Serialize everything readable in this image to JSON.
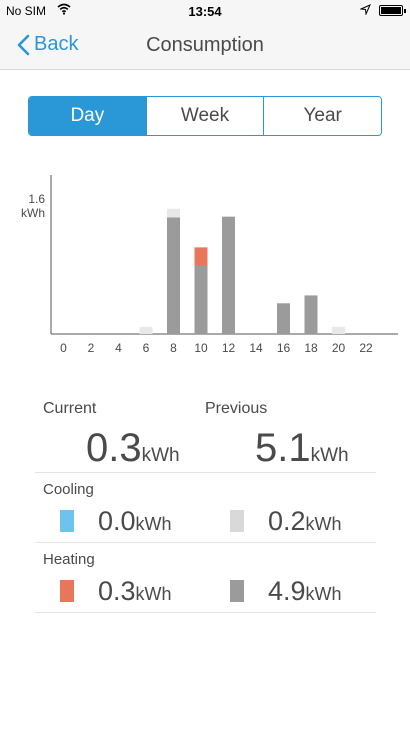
{
  "status_bar": {
    "carrier": "No SIM",
    "time": "13:54"
  },
  "nav": {
    "back_label": "Back",
    "title": "Consumption"
  },
  "segments": [
    {
      "label": "Day",
      "active": true
    },
    {
      "label": "Week",
      "active": false
    },
    {
      "label": "Year",
      "active": false
    }
  ],
  "chart_data": {
    "type": "bar",
    "stacked": true,
    "y_label_value": "1.6",
    "y_label_unit": "kWh",
    "ylim": [
      0,
      1.6
    ],
    "x_tick_labels": [
      "0",
      "2",
      "4",
      "6",
      "8",
      "10",
      "12",
      "14",
      "16",
      "18",
      "20",
      "22"
    ],
    "categories": [
      "0",
      "1",
      "2",
      "3",
      "4",
      "5",
      "6",
      "7",
      "8",
      "9",
      "10",
      "11",
      "12",
      "13",
      "14",
      "15",
      "16",
      "17",
      "18",
      "19",
      "20",
      "21",
      "22",
      "23"
    ],
    "series": [
      {
        "color": "#9b9b9b",
        "values": [
          0,
          0,
          0,
          0,
          0,
          0,
          0,
          0,
          1.48,
          0,
          0.87,
          0,
          1.49,
          0,
          0,
          0,
          0.39,
          0,
          0.49,
          0,
          0,
          0,
          0,
          0
        ]
      },
      {
        "color": "#e8e8e8",
        "values": [
          0,
          0,
          0,
          0,
          0,
          0,
          0.09,
          0,
          0.11,
          0,
          0,
          0,
          0,
          0,
          0,
          0,
          0,
          0,
          0,
          0,
          0.09,
          0,
          0,
          0
        ]
      },
      {
        "color": "#e8765b",
        "values": [
          0,
          0,
          0,
          0,
          0,
          0,
          0,
          0,
          0,
          0,
          0.23,
          0,
          0,
          0,
          0,
          0,
          0,
          0,
          0,
          0,
          0,
          0,
          0,
          0
        ]
      },
      {
        "color": "#6cc4ec",
        "values": [
          0,
          0,
          0,
          0,
          0,
          0,
          0,
          0,
          0,
          0,
          0,
          0,
          0,
          0,
          0,
          0,
          0,
          0,
          0,
          0,
          0,
          0,
          0,
          0
        ]
      }
    ],
    "grid": false
  },
  "summary": {
    "current_label": "Current",
    "previous_label": "Previous",
    "current_value": "0.3",
    "previous_value": "5.1",
    "unit": "kWh",
    "cooling": {
      "title": "Cooling",
      "current": "0.0",
      "previous": "0.2",
      "current_color": "#6cc4ec",
      "previous_color": "#d9d9d9"
    },
    "heating": {
      "title": "Heating",
      "current": "0.3",
      "previous": "4.9",
      "current_color": "#e8765b",
      "previous_color": "#9b9b9b"
    }
  },
  "colors": {
    "accent": "#2a97d6",
    "text": "#4a4a4a"
  }
}
